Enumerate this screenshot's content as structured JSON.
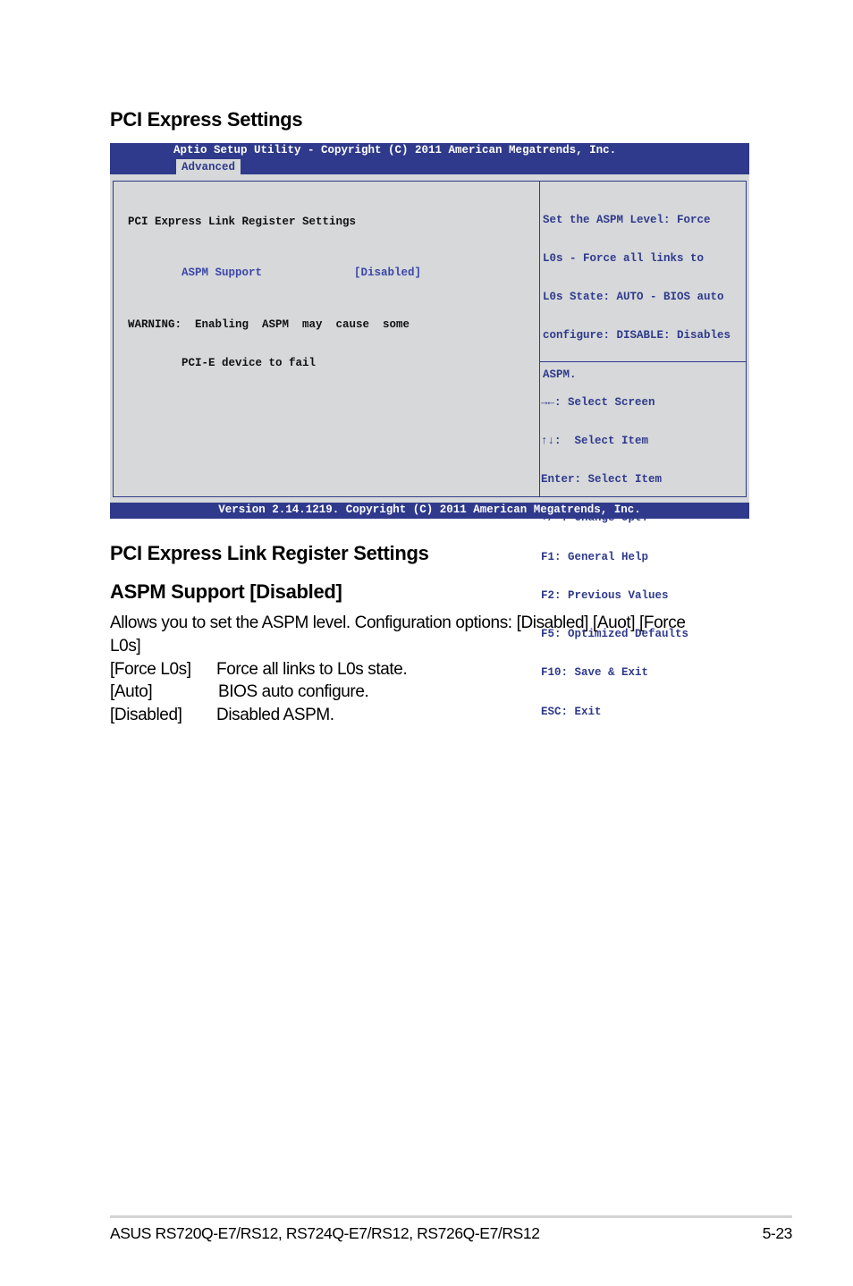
{
  "section_title": "PCI Express Settings",
  "bios": {
    "title": "Aptio Setup Utility - Copyright (C) 2011 American Megatrends, Inc.",
    "active_tab": "Advanced",
    "main": {
      "heading": "PCI Express Link Register Settings",
      "item_label": "ASPM Support",
      "item_value": "[Disabled]",
      "warning_line1": "WARNING:  Enabling  ASPM  may  cause  some",
      "warning_line2": "        PCI-E device to fail"
    },
    "help": {
      "lines": [
        "Set the ASPM Level: Force",
        "L0s - Force all links to",
        "L0s State: AUTO - BIOS auto",
        "configure: DISABLE: Disables",
        "ASPM."
      ]
    },
    "keys": [
      "→←: Select Screen",
      "↑↓:  Select Item",
      "Enter: Select Item",
      "+/-: Change Opt.",
      "F1: General Help",
      "F2: Previous Values",
      "F5: Optimized Defaults",
      "F10: Save & Exit",
      "ESC: Exit"
    ],
    "version": "Version 2.14.1219. Copyright (C) 2011 American Megatrends, Inc."
  },
  "subsection_title": "PCI Express Link Register Settings",
  "item_title": "ASPM Support [Disabled]",
  "description_line1": "Allows you to set the ASPM level. Configuration options: [Disabled] [Auot] [Force",
  "description_line2": "L0s]",
  "options": [
    {
      "key": "[Force L0s]",
      "desc": "Force all links to L0s state."
    },
    {
      "key": "[Auto]",
      "desc": "BIOS auto configure."
    },
    {
      "key": "[Disabled]",
      "desc": "Disabled ASPM."
    }
  ],
  "footer": {
    "product": "ASUS RS720Q-E7/RS12, RS724Q-E7/RS12, RS726Q-E7/RS12",
    "page": "5-23"
  }
}
